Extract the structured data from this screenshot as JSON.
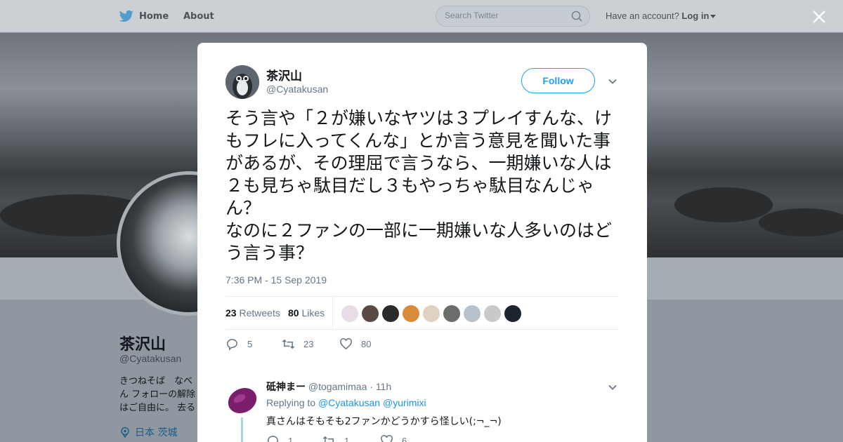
{
  "nav": {
    "home_label": "Home",
    "about_label": "About",
    "search_placeholder": "Search Twitter",
    "account_prompt": "Have an account?",
    "login_label": "Log in",
    "brand_color": "#1da1f2"
  },
  "background_profile": {
    "name": "茶沢山",
    "handle": "@Cyatakusan",
    "bio": "きつねそば　なべ\nん フォローの解除\nはご自由に。 去る",
    "location": "日本 茨城"
  },
  "tweet": {
    "author_name": "茶沢山",
    "author_handle": "@Cyatakusan",
    "follow_label": "Follow",
    "text": "そう言や「２が嫌いなヤツは３プレイすんな、けもフレに入ってくんな」とか言う意見を聞いた事があるが、その理屈で言うなら、一期嫌いな人は２も見ちゃ駄目だし３もやっちゃ駄目なんじゃん？\nなのに２ファンの一部に一期嫌いな人多いのはどう言う事？",
    "timestamp": "7:36 PM - 15 Sep 2019",
    "retweets_count": "23",
    "retweets_label": "Retweets",
    "likes_count": "80",
    "likes_label": "Likes",
    "liker_avatar_colors": [
      "#e8dde6",
      "#5a4a44",
      "#2b2b2b",
      "#d98a3a",
      "#e0d2bf",
      "#6b6d6b",
      "#b8c2cc",
      "#c9c9c9",
      "#1d2430"
    ],
    "action_reply_count": "5",
    "action_retweet_count": "23",
    "action_like_count": "80"
  },
  "reply": {
    "name": "砥神まー",
    "handle": "@togamimaa",
    "separator": "·",
    "time": "11h",
    "replying_prefix": "Replying to",
    "replying_to": [
      "@Cyatakusan",
      "@yurimixi"
    ],
    "text": "真さんはそもそも2ファンかどうかすら怪しい(;¬_¬)",
    "reply_count": "1",
    "retweet_count": "1",
    "like_count": "6"
  }
}
